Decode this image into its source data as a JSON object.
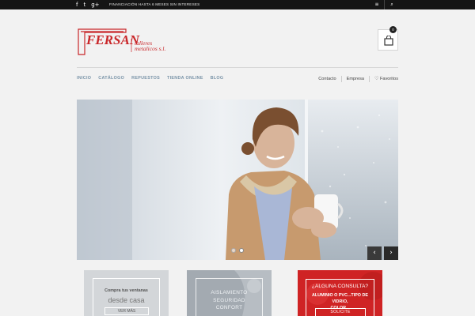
{
  "topbar": {
    "social_icons": [
      "facebook-icon",
      "twitter-icon",
      "google-plus-icon"
    ],
    "social_glyphs": [
      "f",
      "t",
      "g+"
    ],
    "promo_text": "FINANCIACIÓN HASTA 6 MESES SIN INTERESES",
    "menu_glyph": "≡",
    "search_glyph": "⌕"
  },
  "logo": {
    "brand": "FERSAN",
    "subtitle_1": "talleres",
    "subtitle_2": "metalicos s.l."
  },
  "cart": {
    "count": "0"
  },
  "nav": {
    "left": [
      "INICIO",
      "CATÁLOGO",
      "REPUESTOS",
      "TIENDA ONLINE",
      "BLOG"
    ],
    "right": {
      "contacto": "Contacto",
      "empresa": "Empresa",
      "favoritos": "Favoritos"
    }
  },
  "slider": {
    "arrow_prev": "‹",
    "arrow_next": "›",
    "slide_count": 2,
    "active_slide": 2
  },
  "promos": {
    "box1": {
      "line1": "Compra tus ventanas",
      "line2": "desde casa",
      "button": "VER MÁS"
    },
    "box2": {
      "line1": "AISLAMIENTO",
      "line2": "SEGURIDAD",
      "line3": "CONFORT"
    },
    "box3": {
      "question": "¿ALGUNA CONSULTA?",
      "line1": "ALUMINIO O PVC...TIPO DE VIDRIO,",
      "line2": "COLOR...",
      "button": "SOLICITE INFORMACIÓN"
    }
  },
  "colors": {
    "brand_red": "#d32627",
    "nav_blue": "#7a94a8",
    "topbar": "#151515"
  }
}
